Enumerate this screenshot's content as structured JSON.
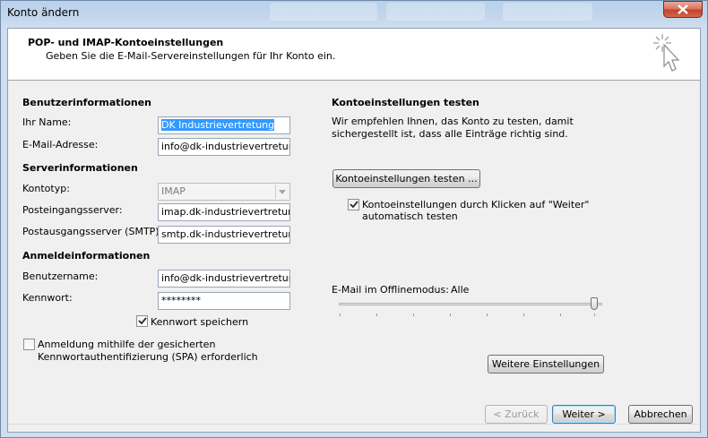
{
  "window": {
    "title": "Konto ändern"
  },
  "header": {
    "title": "POP- und IMAP-Kontoeinstellungen",
    "subtitle": "Geben Sie die E-Mail-Servereinstellungen für Ihr Konto ein."
  },
  "user_info": {
    "section_title": "Benutzerinformationen",
    "name_label": "Ihr Name:",
    "name_value": "DK Industrievertretung",
    "email_label": "E-Mail-Adresse:",
    "email_value": "info@dk-industrievertretung"
  },
  "server_info": {
    "section_title": "Serverinformationen",
    "account_type_label": "Kontotyp:",
    "account_type_value": "IMAP",
    "incoming_label": "Posteingangsserver:",
    "incoming_value": "imap.dk-industrievertretung",
    "outgoing_label": "Postausgangsserver (SMTP):",
    "outgoing_value": "smtp.dk-industrievertretung"
  },
  "login_info": {
    "section_title": "Anmeldeinformationen",
    "username_label": "Benutzername:",
    "username_value": "info@dk-industrievertretung",
    "password_label": "Kennwort:",
    "password_value": "********",
    "remember_password_label": "Kennwort speichern",
    "remember_password_checked": true,
    "spa_label_line1": "Anmeldung mithilfe der gesicherten",
    "spa_label_line2": "Kennwortauthentifizierung (SPA) erforderlich",
    "spa_checked": false
  },
  "test_settings": {
    "section_title": "Kontoeinstellungen testen",
    "description_line1": "Wir empfehlen Ihnen, das Konto zu testen, damit",
    "description_line2": "sichergestellt ist, dass alle Einträge richtig sind.",
    "test_button_label": "Kontoeinstellungen testen ...",
    "auto_test_label_line1": "Kontoeinstellungen durch Klicken auf \"Weiter\"",
    "auto_test_label_line2": "automatisch testen",
    "auto_test_checked": true
  },
  "offline_mode": {
    "label": "E-Mail im Offlinemodus:",
    "value": "Alle",
    "slider_level": 1.0
  },
  "more_settings_button_label": "Weitere Einstellungen",
  "footer": {
    "back_label": "< Zurück",
    "next_label": "Weiter >",
    "cancel_label": "Abbrechen"
  }
}
